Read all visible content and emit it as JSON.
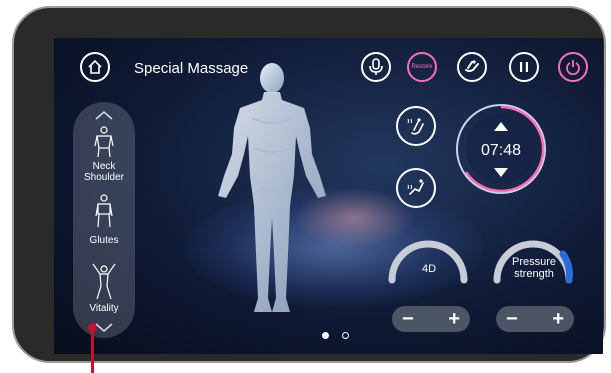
{
  "header": {
    "title": "Special Massage",
    "restore_label": "Restore"
  },
  "sidebar": {
    "items": [
      {
        "label": "Neck\nShoulder",
        "line1": "Neck",
        "line2": "Shoulder"
      },
      {
        "label": "Glutes"
      },
      {
        "label": "Vitality"
      }
    ]
  },
  "timer": {
    "value": "07:48"
  },
  "controls": {
    "knob_4d_label": "4D",
    "pressure_label_1": "Pressure",
    "pressure_label_2": "strength",
    "minus": "−",
    "plus": "+"
  },
  "pagination": {
    "pages": 2,
    "current": 1
  },
  "colors": {
    "accent_pink": "#ff6fb5",
    "accent_blue": "#2f6bd6",
    "pointer_red": "#c8102e"
  }
}
